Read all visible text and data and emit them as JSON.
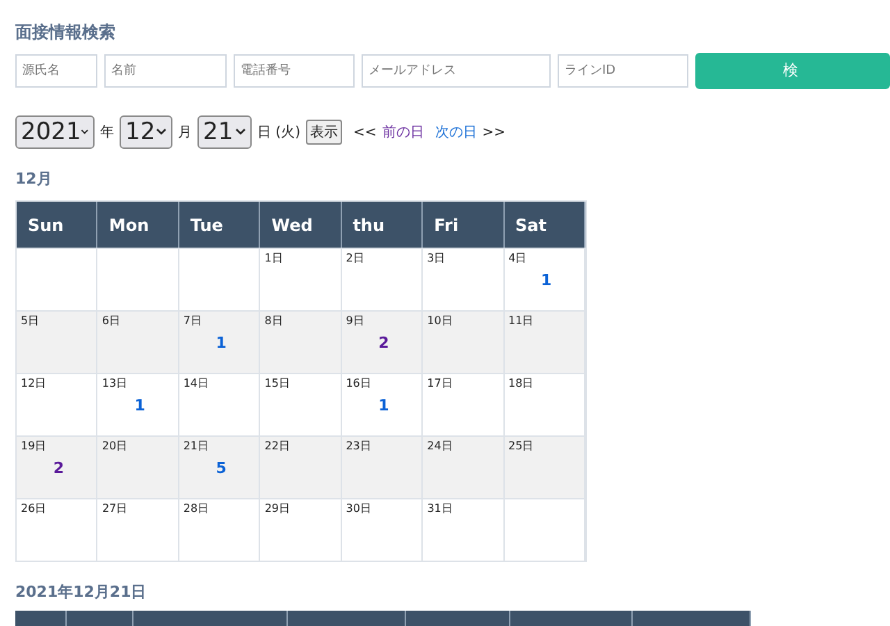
{
  "title": "面接情報検索",
  "search": {
    "fields": [
      {
        "placeholder": "源氏名"
      },
      {
        "placeholder": "名前"
      },
      {
        "placeholder": "電話番号"
      },
      {
        "placeholder": "メールアドレス"
      },
      {
        "placeholder": "ラインID"
      }
    ],
    "button": "検"
  },
  "date_picker": {
    "year": "2021",
    "year_unit": "年",
    "month": "12",
    "month_unit": "月",
    "day": "21",
    "day_unit": "日 (火)",
    "show_button": "表示",
    "prev_arrows": "<<",
    "prev_link": "前の日",
    "next_link": "次の日",
    "next_arrows": ">>"
  },
  "month_title": "12月",
  "calendar": {
    "columns": [
      "Sun",
      "Mon",
      "Tue",
      "Wed",
      "thu",
      "Fri",
      "Sat"
    ],
    "weeks": [
      {
        "shaded": false,
        "days": [
          {
            "kind": "blank"
          },
          {
            "kind": "blank"
          },
          {
            "kind": "blank"
          },
          {
            "day": "1日"
          },
          {
            "day": "2日"
          },
          {
            "day": "3日"
          },
          {
            "day": "4日",
            "count": "1",
            "color": "#0b62d6"
          }
        ]
      },
      {
        "shaded": true,
        "days": [
          {
            "day": "5日"
          },
          {
            "day": "6日"
          },
          {
            "day": "7日",
            "count": "1",
            "color": "#0b62d6"
          },
          {
            "day": "8日"
          },
          {
            "day": "9日",
            "count": "2",
            "color": "#5a1a9a"
          },
          {
            "day": "10日"
          },
          {
            "day": "11日"
          }
        ]
      },
      {
        "shaded": false,
        "days": [
          {
            "day": "12日"
          },
          {
            "day": "13日",
            "count": "1",
            "color": "#0b62d6"
          },
          {
            "day": "14日"
          },
          {
            "day": "15日"
          },
          {
            "day": "16日",
            "count": "1",
            "color": "#0b62d6"
          },
          {
            "day": "17日"
          },
          {
            "day": "18日"
          }
        ]
      },
      {
        "shaded": true,
        "days": [
          {
            "day": "19日",
            "count": "2",
            "color": "#5a1a9a"
          },
          {
            "day": "20日"
          },
          {
            "day": "21日",
            "count": "5",
            "color": "#0b62d6"
          },
          {
            "day": "22日"
          },
          {
            "day": "23日"
          },
          {
            "day": "24日"
          },
          {
            "day": "25日"
          }
        ]
      },
      {
        "shaded": false,
        "days": [
          {
            "day": "26日"
          },
          {
            "day": "27日"
          },
          {
            "day": "28日"
          },
          {
            "day": "29日"
          },
          {
            "day": "30日"
          },
          {
            "day": "31日"
          },
          {
            "kind": "blank"
          }
        ]
      }
    ]
  },
  "day_title": "2021年12月21日"
}
